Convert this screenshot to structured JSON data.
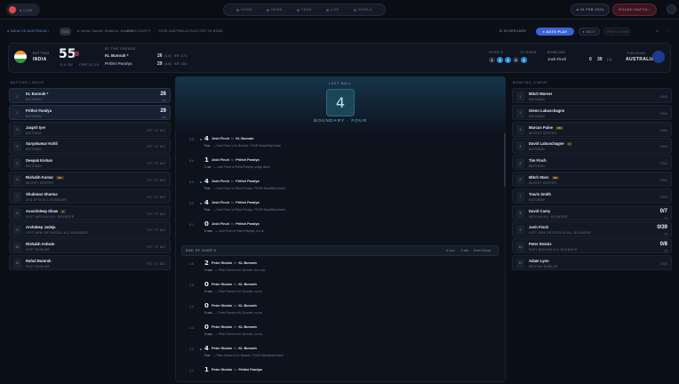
{
  "topbar": {
    "logo": "● LIVE",
    "nav": [
      "HOME",
      "NEWS",
      "TEAM",
      "LIVE",
      "WORLD"
    ],
    "date": "● 15 FEB 2024",
    "round": "ROUND MATCH ›"
  },
  "subbar": {
    "series": "● INDIA VS AUSTRALIA ›",
    "format": "T20",
    "venue": "● Indira Gandhi Stadium, Mumbai",
    "pitch": "PITCH DUSTY",
    "toss": "TOSS AUSTRALIA ELECTED TO BOWL",
    "scorecard": "⊟ SCORECARD",
    "autoplay": "● AUTO PLAY",
    "next": "● NEXT",
    "prev": "◦ PREV OVER",
    "close": "✕"
  },
  "score": {
    "batting_label": "BATTING",
    "team": "INDIA",
    "runs": "55",
    "wkts": "/0",
    "overs": "5.4 OV",
    "crr": "CRR 10.29",
    "at_crease_label": "AT THE CREASE",
    "batters": [
      {
        "name": "KL Bumrah *",
        "runs": "26",
        "balls": "(15)",
        "sr": "SR 173"
      },
      {
        "name": "Prithvi Pandya",
        "runs": "29",
        "balls": "(16)",
        "sr": "SR 181"
      }
    ],
    "this_over_label": "OVER 6",
    "balls": [
      "1",
      "4",
      "4",
      "0",
      "4"
    ],
    "balls_sub": "13 RUNS",
    "bowling_label_small": "BOWLING",
    "bowler": "Josh Finch",
    "bowler_fig": "0",
    "bowler_fig2": "39",
    "bowler_overs": "(4)",
    "fielding_label": "FIELDING",
    "fielding_team": "AUSTRALIA"
  },
  "left_panel": {
    "title": "BATTING LINEUP",
    "players": [
      {
        "num": "1",
        "name": "KL Bumrah *",
        "role": "BATSMAN",
        "stat": "26",
        "sub": "(15)"
      },
      {
        "num": "2",
        "name": "Prithvi Pandya",
        "role": "BATSMAN",
        "stat": "29",
        "sub": "(16)"
      },
      {
        "num": "3",
        "name": "Jasprit Iyer",
        "role": "BATSMAN",
        "yet": "YET TO BAT"
      },
      {
        "num": "4",
        "name": "Suryakumar Kohli",
        "role": "BATSMAN",
        "yet": "YET TO BAT"
      },
      {
        "num": "5",
        "name": "Deepak Kishan",
        "role": "BATSMAN",
        "yet": "YET TO BAT"
      },
      {
        "num": "6",
        "name": "Rishabh Kumar",
        "badge": "WK",
        "role": "WICKET KEEPER",
        "yet": "YET TO BAT"
      },
      {
        "num": "7",
        "name": "Shubman Sharma",
        "role": "LEG SPIN ALL-ROUNDER",
        "yet": "YET TO BAT"
      },
      {
        "num": "8",
        "name": "Axarshdeep Shaw",
        "badge": "C",
        "role": "FAST MEDIUM ALL-ROUNDER",
        "yet": "YET TO BAT"
      },
      {
        "num": "9",
        "name": "Arshdeep Jadeja",
        "role": "LEFT ARM ORTHODOX ALL-ROUNDER",
        "yet": "YET TO BAT"
      },
      {
        "num": "10",
        "name": "Rishabh Ashwin",
        "role": "FAST BOWLER",
        "yet": "YET TO BAT"
      },
      {
        "num": "11",
        "name": "Rahul Bumrah",
        "role": "FAST BOWLER",
        "yet": "YET TO BAT"
      }
    ]
  },
  "right_panel": {
    "title": "BOWLING LINEUP",
    "players": [
      {
        "num": "1",
        "name": "Mitch Warner",
        "role": "BATSMAN",
        "yet": "DNB"
      },
      {
        "num": "2",
        "name": "Glenn Labuschagne",
        "role": "BATSMAN",
        "yet": "DNB"
      },
      {
        "num": "3",
        "name": "Marcus Paine",
        "badge": "WK",
        "role": "WICKET KEEPER",
        "yet": "DNB"
      },
      {
        "num": "4",
        "name": "David Labuschagne",
        "badge": "C",
        "role": "BATSMAN",
        "yet": "DNB"
      },
      {
        "num": "5",
        "name": "Tim Finch",
        "role": "BATSMAN",
        "yet": "DNB"
      },
      {
        "num": "6",
        "name": "Mitch Starc",
        "badge": "WK",
        "role": "WICKET KEEPER",
        "yet": "DNB"
      },
      {
        "num": "7",
        "name": "Travis Smith",
        "role": "BATSMAN",
        "yet": "DNB"
      },
      {
        "num": "8",
        "name": "David Carey",
        "role": "MEDIUM ALL-ROUNDER",
        "stat": "0/7",
        "sub": "(1)"
      },
      {
        "num": "9",
        "name": "Josh Finch",
        "role": "LEFT ARM ORTHODOX ALL-ROUNDER",
        "stat": "0/39",
        "sub": "(4)"
      },
      {
        "num": "10",
        "name": "Peter Stoinis",
        "role": "FAST MEDIUM ALL-ROUNDER",
        "stat": "0/8",
        "sub": "(1)"
      },
      {
        "num": "11",
        "name": "Adam Lyon",
        "role": "MEDIUM BOWLER",
        "yet": "DNB"
      }
    ]
  },
  "center": {
    "last_ball_label": "LAST BALL",
    "last_ball_value": "4",
    "last_ball_result": "BOUNDARY · FOUR",
    "feed": [
      {
        "ov": "5.5",
        "runs": "4",
        "bowler": "Josh Finch",
        "to": "to",
        "batter": "KL Bumrah",
        "lbl": "Four",
        "desc": "— Josh Finch to KL Bumrah, FOUR! Beautifully timed!"
      },
      {
        "ov": "5.4",
        "runs": "1",
        "bowler": "Josh Finch",
        "to": "to",
        "batter": "Prithvi Pandya",
        "lbl": "1 run",
        "desc": "— Josh Finch to Prithvi Pandya, single taken."
      },
      {
        "ov": "5.3",
        "runs": "4",
        "bowler": "Josh Finch",
        "to": "to",
        "batter": "Prithvi Pandya",
        "lbl": "Four",
        "desc": "— Josh Finch to Prithvi Pandya, FOUR! Beautifully timed!"
      },
      {
        "ov": "5.2",
        "runs": "4",
        "bowler": "Josh Finch",
        "to": "to",
        "batter": "Prithvi Pandya",
        "lbl": "Four",
        "desc": "— Josh Finch to Prithvi Pandya, FOUR! Beautifully timed!"
      },
      {
        "ov": "5.1",
        "runs": "0",
        "bowler": "Josh Finch",
        "to": "to",
        "batter": "Prithvi Pandya",
        "lbl": "0 runs",
        "desc": "— Josh Finch to Prithvi Pandya, no run."
      }
    ],
    "end_of_over": "END OF OVER 5",
    "end_runs": "8 runs",
    "end_wkts": "0 wkt",
    "end_bowler": "Peter Stoinis",
    "feed2": [
      {
        "ov": "4.6",
        "runs": "2",
        "bowler": "Peter Stoinis",
        "to": "to",
        "batter": "KL Bumrah",
        "lbl": "2 runs",
        "desc": "— Peter Stoinis to KL Bumrah, two runs."
      },
      {
        "ov": "4.5",
        "runs": "0",
        "bowler": "Peter Stoinis",
        "to": "to",
        "batter": "KL Bumrah",
        "lbl": "0 runs",
        "desc": "— Peter Stoinis to KL Bumrah, no run."
      },
      {
        "ov": "4.4",
        "runs": "0",
        "bowler": "Peter Stoinis",
        "to": "to",
        "batter": "KL Bumrah",
        "lbl": "0 runs",
        "desc": "— Peter Stoinis to KL Bumrah, no run."
      },
      {
        "ov": "4.3",
        "runs": "0",
        "bowler": "Peter Stoinis",
        "to": "to",
        "batter": "KL Bumrah",
        "lbl": "0 runs",
        "desc": "— Peter Stoinis to KL Bumrah, no run."
      },
      {
        "ov": "4.2",
        "runs": "4",
        "bowler": "Peter Stoinis",
        "to": "to",
        "batter": "KL Bumrah",
        "lbl": "Four",
        "desc": "— Peter Stoinis to KL Bumrah, FOUR! Beautifully timed!"
      },
      {
        "ov": "4.1",
        "runs": "1",
        "bowler": "Peter Stoinis",
        "to": "to",
        "batter": "Prithvi Pandya",
        "lbl": "",
        "desc": ""
      }
    ]
  }
}
